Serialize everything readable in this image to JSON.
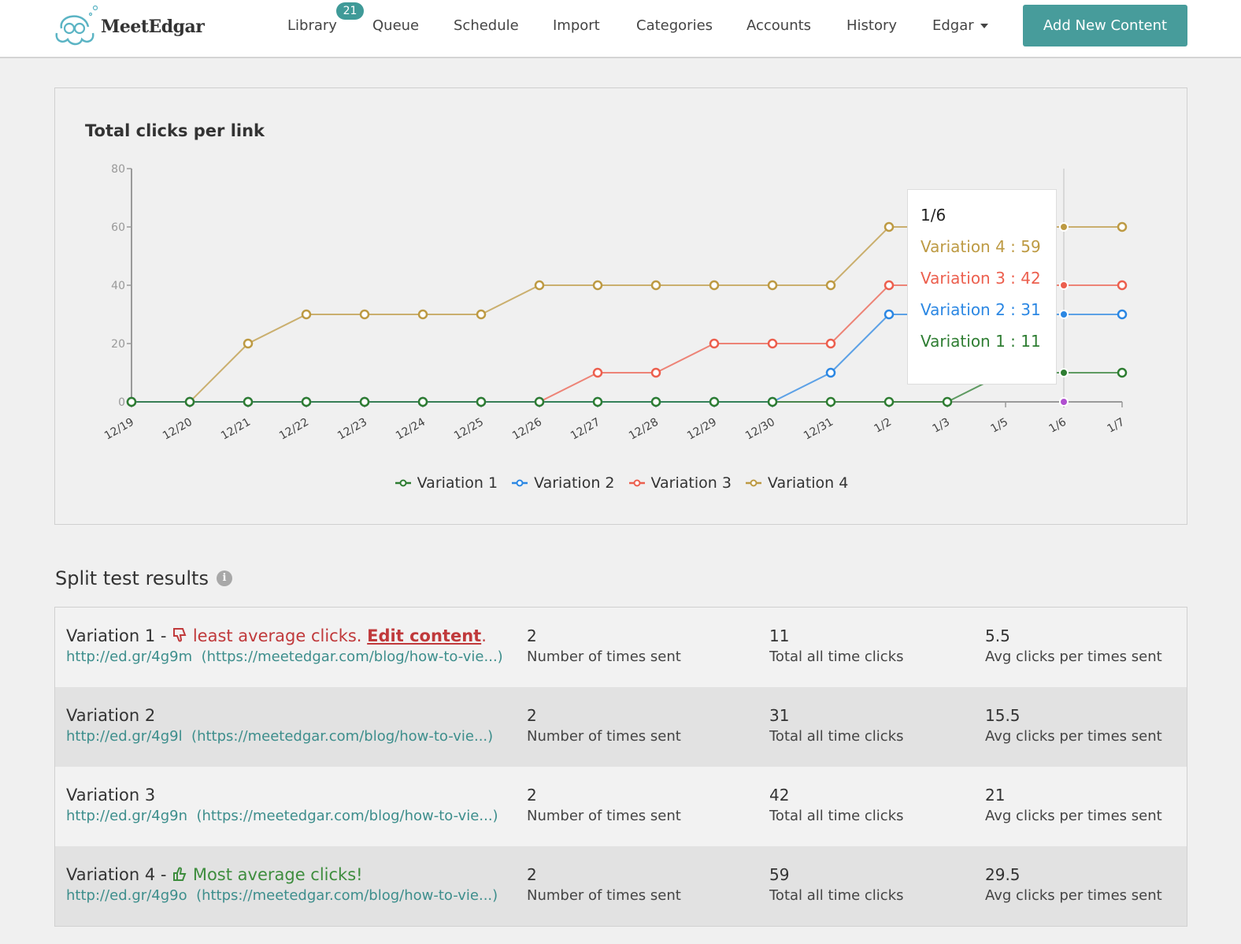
{
  "header": {
    "logo_text": "MeetEdgar",
    "nav": [
      {
        "label": "Library",
        "badge": "21"
      },
      {
        "label": "Queue"
      },
      {
        "label": "Schedule"
      },
      {
        "label": "Import"
      },
      {
        "label": "Categories"
      },
      {
        "label": "Accounts"
      },
      {
        "label": "History"
      },
      {
        "label": "Edgar",
        "icon": "caret-down-icon"
      }
    ],
    "add_button": "Add New Content",
    "brand_color": "#479c9b"
  },
  "chart_data": {
    "type": "line",
    "title": "Total clicks per link",
    "xlabel": "",
    "ylabel": "",
    "ylim": [
      0,
      80
    ],
    "yticks": [
      0,
      20,
      40,
      60,
      80
    ],
    "grid": false,
    "legend_position": "bottom",
    "categories": [
      "12/19",
      "12/20",
      "12/21",
      "12/22",
      "12/23",
      "12/24",
      "12/25",
      "12/26",
      "12/27",
      "12/28",
      "12/29",
      "12/30",
      "12/31",
      "1/2",
      "1/3",
      "1/5",
      "1/6",
      "1/7"
    ],
    "series": [
      {
        "name": "Variation 1",
        "color": "#2e7d32",
        "values": [
          0,
          0,
          0,
          0,
          0,
          0,
          0,
          0,
          0,
          0,
          0,
          0,
          0,
          0,
          0,
          10,
          10,
          10
        ]
      },
      {
        "name": "Variation 2",
        "color": "#2b87e3",
        "values": [
          0,
          0,
          0,
          0,
          0,
          0,
          0,
          0,
          0,
          0,
          0,
          0,
          10,
          30,
          30,
          30,
          30,
          30
        ]
      },
      {
        "name": "Variation 3",
        "color": "#ec5f4e",
        "values": [
          0,
          0,
          0,
          0,
          0,
          0,
          0,
          0,
          10,
          10,
          20,
          20,
          20,
          40,
          40,
          40,
          40,
          40
        ]
      },
      {
        "name": "Variation 4",
        "color": "#bd9a43",
        "values": [
          0,
          0,
          20,
          30,
          30,
          30,
          30,
          40,
          40,
          40,
          40,
          40,
          40,
          60,
          60,
          60,
          60,
          60
        ]
      }
    ],
    "hover": {
      "category": "1/6",
      "tooltip_title": "1/6",
      "items": [
        {
          "label": "Variation 4 : 59",
          "color": "#bd9a43"
        },
        {
          "label": "Variation 3 : 42",
          "color": "#ec5f4e"
        },
        {
          "label": "Variation 2 : 31",
          "color": "#2b87e3"
        },
        {
          "label": "Variation 1 : 11",
          "color": "#2e7d32"
        }
      ]
    }
  },
  "split_test": {
    "title": "Split test results",
    "rows": [
      {
        "name": "Variation 1 - ",
        "status": "negative",
        "status_text": "least average clicks. ",
        "action": "Edit content",
        "after": ".",
        "short_link": "http://ed.gr/4g9m",
        "full_link": "(https://meetedgar.com/blog/how-to-vie...)",
        "times_sent": "2",
        "times_sent_label": "Number of times sent",
        "total_clicks": "11",
        "total_clicks_label": "Total all time clicks",
        "avg_clicks": "5.5",
        "avg_clicks_label": "Avg clicks per times sent"
      },
      {
        "name": "Variation 2",
        "status": "none",
        "short_link": "http://ed.gr/4g9l",
        "full_link": "(https://meetedgar.com/blog/how-to-vie...)",
        "times_sent": "2",
        "times_sent_label": "Number of times sent",
        "total_clicks": "31",
        "total_clicks_label": "Total all time clicks",
        "avg_clicks": "15.5",
        "avg_clicks_label": "Avg clicks per times sent"
      },
      {
        "name": "Variation 3",
        "status": "none",
        "short_link": "http://ed.gr/4g9n",
        "full_link": "(https://meetedgar.com/blog/how-to-vie...)",
        "times_sent": "2",
        "times_sent_label": "Number of times sent",
        "total_clicks": "42",
        "total_clicks_label": "Total all time clicks",
        "avg_clicks": "21",
        "avg_clicks_label": "Avg clicks per times sent"
      },
      {
        "name": "Variation 4 - ",
        "status": "positive",
        "status_text": "Most average clicks!",
        "short_link": "http://ed.gr/4g9o",
        "full_link": "(https://meetedgar.com/blog/how-to-vie...)",
        "times_sent": "2",
        "times_sent_label": "Number of times sent",
        "total_clicks": "59",
        "total_clicks_label": "Total all time clicks",
        "avg_clicks": "29.5",
        "avg_clicks_label": "Avg clicks per times sent"
      }
    ]
  }
}
